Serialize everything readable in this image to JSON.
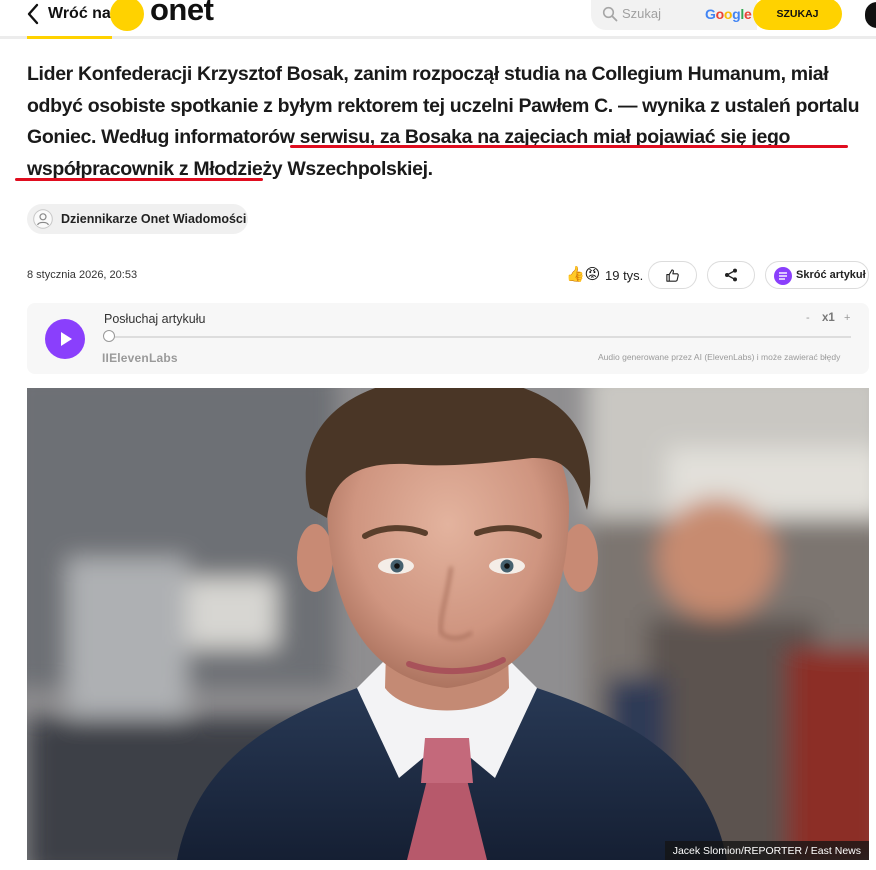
{
  "header": {
    "back_label": "Wróć na",
    "logo_text": "onet",
    "search_placeholder": "Szukaj",
    "google_letters": [
      {
        "ch": "G",
        "color": "#4285f4"
      },
      {
        "ch": "o",
        "color": "#ea4335"
      },
      {
        "ch": "o",
        "color": "#fbbc05"
      },
      {
        "ch": "g",
        "color": "#4285f4"
      },
      {
        "ch": "l",
        "color": "#34a853"
      },
      {
        "ch": "e",
        "color": "#ea4335"
      }
    ],
    "search_button": "SZUKAJ"
  },
  "article": {
    "lead_before": "Lider Konfederacji Krzysztof Bosak, zanim rozpoczął studia na Collegium Humanum, miał odbyć osobiste spotkanie z byłym rektorem tej uczelni Pawłem C. — wynika z ustaleń portalu Goniec. Według informatorów serwisu, ",
    "lead_highlight": "za Bosaka na zajęciach miał pojawiać się jego współpracownik z Młodzieży Wszechpolskiej.",
    "author": "Dziennikarze Onet Wiadomości",
    "date": "8 stycznia 2026, 20:53",
    "reactions_count": "19 tys.",
    "summary_button": "Skróć artykuł"
  },
  "player": {
    "title": "Posłuchaj artykułu",
    "speed_minus": "-",
    "speed": "x1",
    "speed_plus": "+",
    "provider": "IIElevenLabs",
    "disclaimer": "Audio generowane przez AI (ElevenLabs) i może zawierać błędy",
    "progress": 0
  },
  "photo": {
    "credit": "Jacek Slomion/REPORTER / East News"
  },
  "colors": {
    "accent_yellow": "#ffd200",
    "highlight_red": "#e00d1f",
    "player_purple": "#8a3ffc"
  },
  "icons": {
    "back": "chevron-left-icon",
    "search": "search-icon",
    "like": "thumbs-up-icon",
    "share": "share-icon",
    "summary": "summary-list-icon",
    "play": "play-icon",
    "author": "user-icon"
  }
}
